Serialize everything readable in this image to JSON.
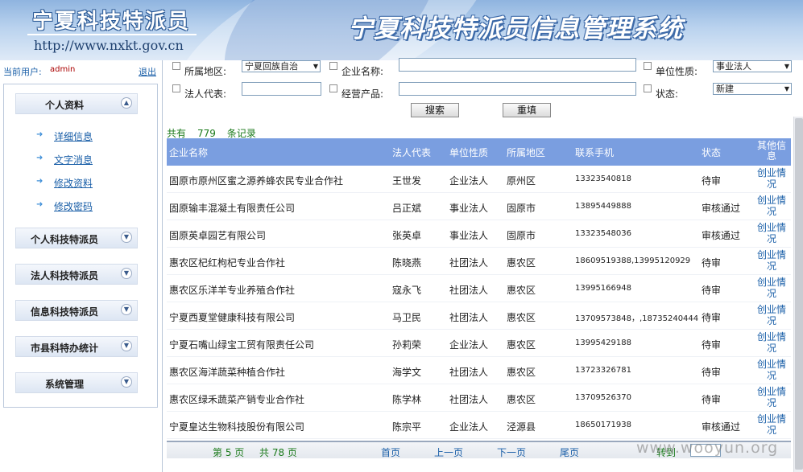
{
  "header": {
    "logo_title": "宁夏科技特派员",
    "logo_url": "http://www.nxkt.gov.cn",
    "system_title": "宁夏科技特派员信息管理系统"
  },
  "user": {
    "label": "当前用户:",
    "name": "admin",
    "logout": "退出"
  },
  "sidebar": {
    "sections": [
      {
        "title": "个人资料",
        "expanded": true
      },
      {
        "title": "个人科技特派员",
        "expanded": false
      },
      {
        "title": "法人科技特派员",
        "expanded": false
      },
      {
        "title": "信息科技特派员",
        "expanded": false
      },
      {
        "title": "市县科特办统计",
        "expanded": false
      },
      {
        "title": "系统管理",
        "expanded": false
      }
    ],
    "profile_items": [
      "详细信息",
      "文字消息",
      "修改资料",
      "修改密码"
    ]
  },
  "search": {
    "region_label": "所属地区:",
    "region_value": "宁夏回族自治",
    "company_label": "企业名称:",
    "company_value": "",
    "unit_type_label": "单位性质:",
    "unit_type_value": "事业法人",
    "legal_rep_label": "法人代表:",
    "legal_rep_value": "",
    "product_label": "经营产品:",
    "product_value": "",
    "status_label": "状态:",
    "status_value": "新建",
    "search_button": "搜索",
    "reset_button": "重填"
  },
  "summary": {
    "prefix": "共有",
    "count": "779",
    "suffix": "条记录"
  },
  "table": {
    "columns": [
      "企业名称",
      "法人代表",
      "单位性质",
      "所属地区",
      "联系手机",
      "状态",
      "其他信息"
    ],
    "rows": [
      {
        "company": "固原市原州区蜜之源养蜂农民专业合作社",
        "rep": "王世发",
        "type": "企业法人",
        "region": "原州区",
        "phone": "13323540818",
        "status": "待审",
        "other": "创业情况"
      },
      {
        "company": "固原输丰混凝土有限责任公司",
        "rep": "吕正斌",
        "type": "事业法人",
        "region": "固原市",
        "phone": "13895449888",
        "status": "审核通过",
        "other": "创业情况"
      },
      {
        "company": "固原英卓园艺有限公司",
        "rep": "张英卓",
        "type": "事业法人",
        "region": "固原市",
        "phone": "13323548036",
        "status": "审核通过",
        "other": "创业情况"
      },
      {
        "company": "惠农区杞红枸杞专业合作社",
        "rep": "陈晓燕",
        "type": "社团法人",
        "region": "惠农区",
        "phone": "18609519388,13995120929",
        "status": "待审",
        "other": "创业情况"
      },
      {
        "company": "惠农区乐洋羊专业养殖合作社",
        "rep": "寇永飞",
        "type": "社团法人",
        "region": "惠农区",
        "phone": "13995166948",
        "status": "待审",
        "other": "创业情况"
      },
      {
        "company": "宁夏西夏堂健康科技有限公司",
        "rep": "马卫民",
        "type": "社团法人",
        "region": "惠农区",
        "phone": "13709573848，,18735240444",
        "status": "待审",
        "other": "创业情况"
      },
      {
        "company": "宁夏石嘴山绿宝工贸有限责任公司",
        "rep": "孙莉荣",
        "type": "企业法人",
        "region": "惠农区",
        "phone": "13995429188",
        "status": "待审",
        "other": "创业情况"
      },
      {
        "company": "惠农区海洋蔬菜种植合作社",
        "rep": "海学文",
        "type": "社团法人",
        "region": "惠农区",
        "phone": "13723326781",
        "status": "待审",
        "other": "创业情况"
      },
      {
        "company": "惠农区绿禾蔬菜产销专业合作社",
        "rep": "陈学林",
        "type": "社团法人",
        "region": "惠农区",
        "phone": "13709526370",
        "status": "待审",
        "other": "创业情况"
      },
      {
        "company": "宁夏皇达生物科技股份有限公司",
        "rep": "陈宗平",
        "type": "企业法人",
        "region": "泾源县",
        "phone": "18650171938",
        "status": "审核通过",
        "other": "创业情况"
      }
    ]
  },
  "pager": {
    "current": "第 5 页",
    "total": "共 78 页",
    "first": "首页",
    "prev": "上一页",
    "next": "下一页",
    "last": "尾页",
    "goto": "转到"
  },
  "watermark": "www.wooyun.org",
  "colors": {
    "table_header": "#7a9ee0",
    "link": "#1a5fa8",
    "summary_green": "#1b7a1b"
  }
}
